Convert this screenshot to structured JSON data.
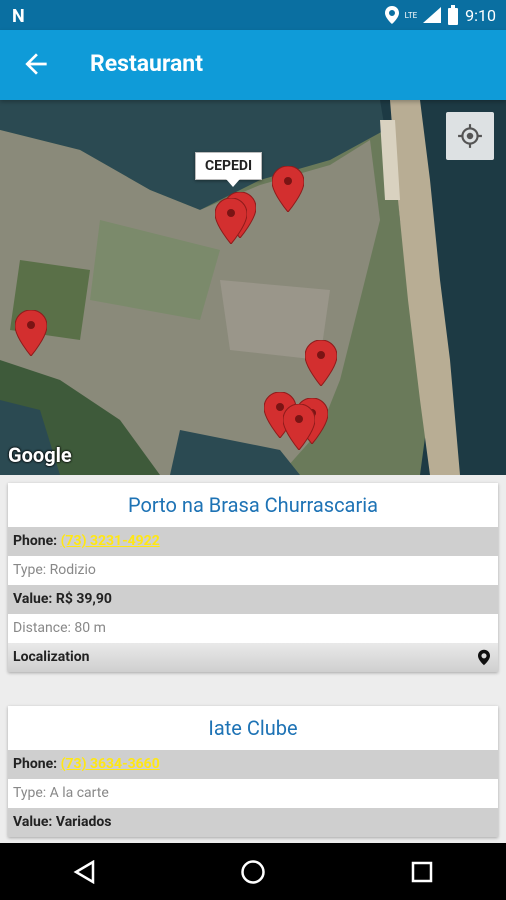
{
  "status_bar": {
    "time": "9:10",
    "network": "LTE"
  },
  "app_bar": {
    "title": "Restaurant"
  },
  "map": {
    "callout_label": "CEPEDI",
    "attribution": "Google"
  },
  "restaurants": [
    {
      "name": "Porto na Brasa Churrascaria",
      "phone_label": "Phone:",
      "phone": "(73) 3231-4922",
      "type": "Type: Rodizio",
      "value_label": "Value:",
      "value": "R$ 39,90",
      "distance": "Distance: 80 m",
      "localization": "Localization"
    },
    {
      "name": "Iate Clube",
      "phone_label": "Phone:",
      "phone": "(73) 3634-3660",
      "type": "Type: A la carte",
      "value_label": "Value:",
      "value": "Variados"
    }
  ],
  "colors": {
    "app_bar": "#0f9bd8",
    "status_bar": "#0a6fa1",
    "title_text": "#1e73b5",
    "phone_text": "#ffe714",
    "pin": "#d32f2f"
  }
}
